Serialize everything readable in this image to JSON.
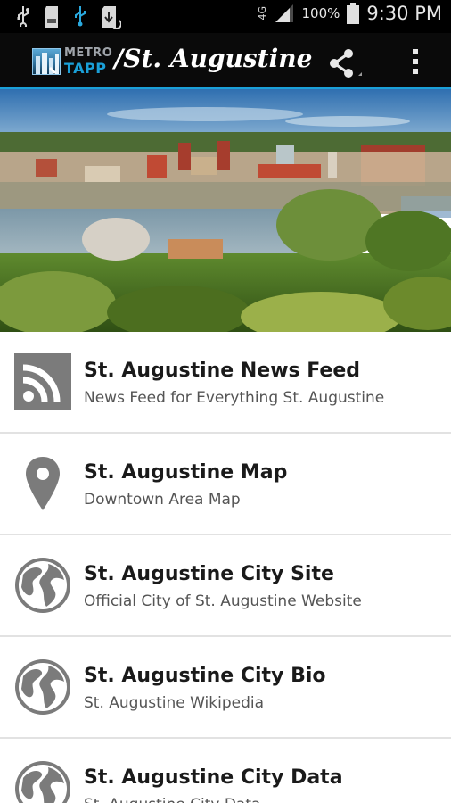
{
  "status_bar": {
    "left_icons": [
      "usb-icon",
      "sd-card-icon",
      "usb-debug-icon",
      "download-icon"
    ],
    "network_type": "4G",
    "battery_percent": "100%",
    "time": "9:30 PM"
  },
  "app_bar": {
    "logo_metro": "METRO",
    "logo_tapp": "TAPP",
    "title": "/St. Augustine",
    "accent_color": "#1aa0d8",
    "actions": [
      "share-icon",
      "overflow-menu-icon"
    ]
  },
  "items": [
    {
      "title": "St. Augustine News Feed",
      "subtitle": "News Feed for Everything St. Augustine",
      "icon": "rss-feed-icon"
    },
    {
      "title": "St. Augustine Map",
      "subtitle": "Downtown Area Map",
      "icon": "map-pin-icon"
    },
    {
      "title": "St. Augustine City Site",
      "subtitle": "Official City of St. Augustine Website",
      "icon": "globe-icon"
    },
    {
      "title": "St. Augustine City Bio",
      "subtitle": "St. Augustine Wikipedia",
      "icon": "globe-icon"
    },
    {
      "title": "St. Augustine City Data",
      "subtitle": "St. Augustine City Data",
      "icon": "globe-icon"
    }
  ]
}
